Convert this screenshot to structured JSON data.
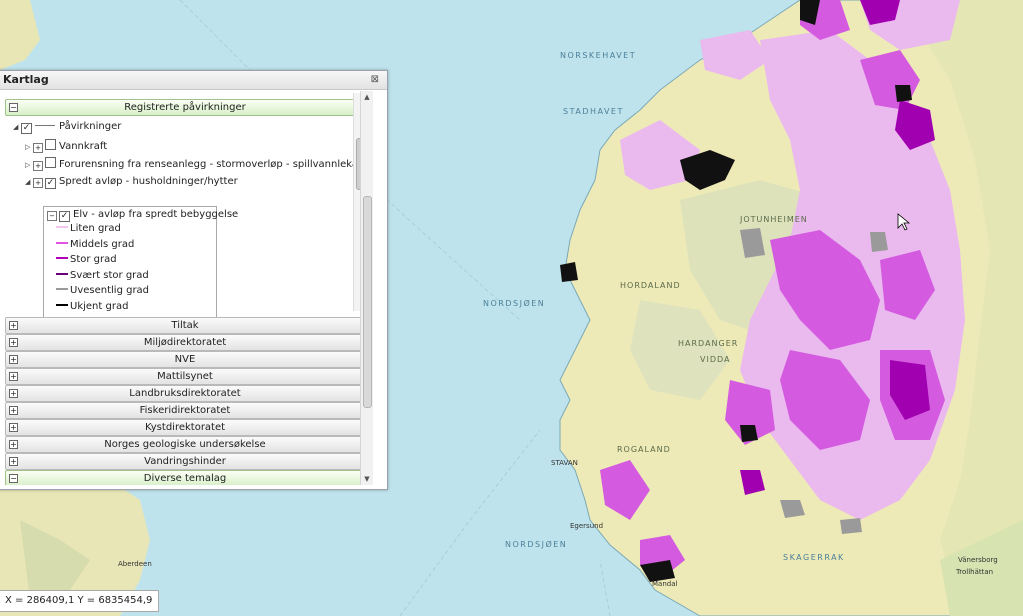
{
  "panel": {
    "title": "Kartlag",
    "close_glyph": "⊠",
    "groups": {
      "registrerte": "Registrerte påvirkninger",
      "tiltak": "Tiltak",
      "miljo": "Miljødirektoratet",
      "nve": "NVE",
      "mattilsynet": "Mattilsynet",
      "landbruk": "Landbruksdirektoratet",
      "fiskeri": "Fiskeridirektoratet",
      "kyst": "Kystdirektoratet",
      "ngu": "Norges geologiske undersøkelse",
      "vandring": "Vandringshinder",
      "diverse": "Diverse temalag"
    },
    "tree": {
      "root": "Påvirkninger",
      "vannkraft": "Vannkraft",
      "forurensning": "Forurensning fra renseanlegg - stormoverløp - spillvannlekasje",
      "spredt": "Spredt avløp - husholdninger/hytter",
      "elv": "Elv - avløp fra spredt bebyggelse"
    },
    "legend": [
      {
        "label": "Liten grad",
        "color": "#f2c6f0"
      },
      {
        "label": "Middels grad",
        "color": "#e055e0"
      },
      {
        "label": "Stor grad",
        "color": "#b000b8"
      },
      {
        "label": "Svært stor grad",
        "color": "#6a007a"
      },
      {
        "label": "Uvesentlig grad",
        "color": "#9a9a9a"
      },
      {
        "label": "Ukjent grad",
        "color": "#000000"
      }
    ]
  },
  "map": {
    "labels": {
      "norskehavet": "NORSKEHAVET",
      "stadhavet": "STADHAVET",
      "nordsjoen1": "NORDSJØEN",
      "nordsjoen2": "NORDSJØEN",
      "skagerrak": "SKAGERRAK",
      "jotunheimen": "JOTUNHEIMEN",
      "hardanger": "HARDANGER",
      "vidda": "VIDDA",
      "rogaland": "ROGALAND",
      "hordaland": "HORDALAND",
      "stavan": "STAVAN",
      "mandal": "Mandal",
      "egersund": "Egersund",
      "aberdeen": "Aberdeen",
      "vanersborg": "Vänersborg",
      "trollhattan": "Trollhättan"
    },
    "colors": {
      "sea": "#bfe3ec",
      "land": "#eeeab8",
      "mountain": "#d9dfb8",
      "light_impact": "#eab9ee",
      "medium_impact": "#d45be0",
      "high_impact": "#a000b0"
    }
  },
  "status": {
    "coordinates": "X = 286409,1  Y = 6835454,9"
  }
}
